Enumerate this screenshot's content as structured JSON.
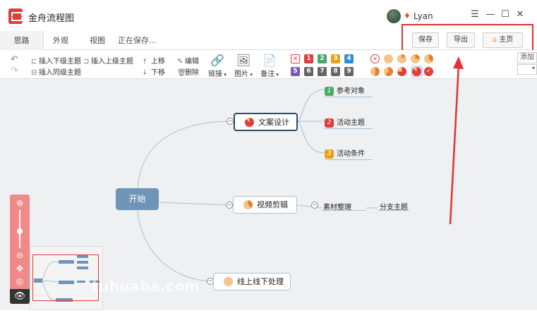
{
  "app": {
    "title": "金舟流程图",
    "username": "Lyan"
  },
  "window_controls": {
    "menu": "☰",
    "minimize": "—",
    "maximize": "☐",
    "close": "✕"
  },
  "tabs": [
    {
      "label": "思路"
    },
    {
      "label": "外观"
    },
    {
      "label": "视图"
    }
  ],
  "status_text": "正在保存...",
  "top_buttons": {
    "save": "保存",
    "export": "导出",
    "home": "主页"
  },
  "toolbar": {
    "insert_sub": "插入下级主题",
    "insert_parent": "插入上级主题",
    "insert_sibling": "插入同级主题",
    "move_up": "上移",
    "move_down": "下移",
    "edit": "编辑",
    "delete": "删除",
    "link": "链接",
    "image": "图片",
    "note": "备注",
    "add_field": "添加"
  },
  "priority_icons": [
    "1",
    "2",
    "3",
    "4",
    "5",
    "6",
    "7",
    "8",
    "9"
  ],
  "mindmap": {
    "root": "开始",
    "branches": [
      {
        "label": "文案设计",
        "progress": 0.875
      },
      {
        "label": "视频剪辑",
        "progress": 0.375
      },
      {
        "label": "线上线下处理",
        "progress": 0
      }
    ],
    "sub_topics": [
      {
        "badge": "1",
        "label": "参考对象",
        "color": "#4aa86a"
      },
      {
        "badge": "2",
        "label": "活动主题",
        "color": "#e23c3c"
      },
      {
        "badge": "3",
        "label": "活动条件",
        "color": "#e8a21a"
      }
    ],
    "material": "素材整理",
    "branch_topic": "分支主题"
  },
  "watermark": "tuhuaba.com",
  "colors": {
    "brand": "#e23c3c",
    "root_node": "#6e95b8",
    "zoom_panel": "#f08a8a",
    "annotation": "#e83030"
  }
}
